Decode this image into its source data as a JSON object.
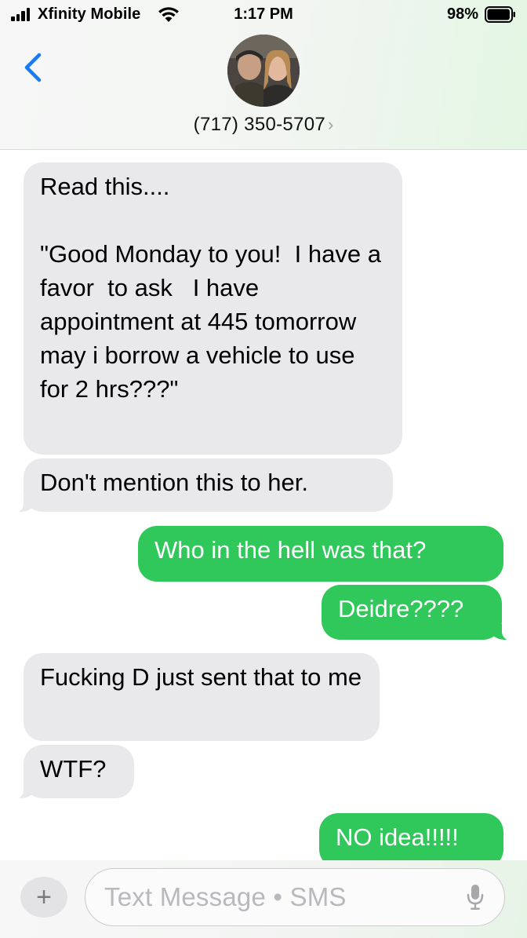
{
  "status_bar": {
    "carrier": "Xfinity Mobile",
    "time": "1:17 PM",
    "battery_percent": "98%",
    "battery_level": 0.98
  },
  "header": {
    "contact": "(717) 350-5707",
    "chevron": "›"
  },
  "messages": [
    {
      "direction": "incoming",
      "text": "Read this....\n\n\"Good Monday to you!  I have a favor  to ask   I have  appointment at 445 tomorrow  may i borrow a vehicle to use for 2 hrs???\""
    },
    {
      "direction": "incoming",
      "text": "Don't mention this to her."
    },
    {
      "direction": "outgoing",
      "text": "Who in the hell was that?"
    },
    {
      "direction": "outgoing",
      "text": "Deidre????"
    },
    {
      "direction": "incoming",
      "text": "Fucking D just sent that to me"
    },
    {
      "direction": "incoming",
      "text": "WTF?"
    },
    {
      "direction": "outgoing",
      "text": "NO idea!!!!!"
    }
  ],
  "compose": {
    "plus_label": "+",
    "placeholder": "Text Message • SMS"
  },
  "colors": {
    "incoming_bubble": "#e9e9eb",
    "outgoing_bubble": "#30c85a",
    "accent_blue": "#1a7cf5"
  }
}
